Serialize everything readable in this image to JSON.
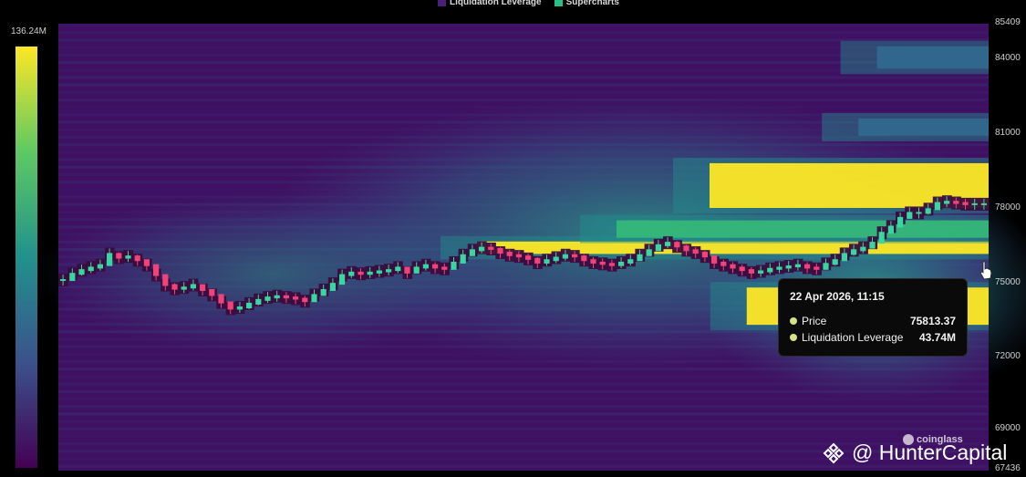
{
  "legend": {
    "items": [
      {
        "label": "Liquidation Leverage",
        "color": "#4a1f78"
      },
      {
        "label": "Supercharts",
        "color": "#26c08a"
      }
    ]
  },
  "color_scale": {
    "max_label": "136.24M",
    "colors": [
      "#440154",
      "#3b528b",
      "#21918c",
      "#5ec962",
      "#fde725"
    ]
  },
  "tooltip": {
    "date": "22 Apr 2026, 11:15",
    "rows": [
      {
        "label": "Price",
        "value": "75813.37"
      },
      {
        "label": "Liquidation Leverage",
        "value": "43.74M"
      }
    ]
  },
  "watermark": {
    "text": "coinglass",
    "icon": "coinglass-logo-icon"
  },
  "credit": {
    "text": "@ HunterCapital",
    "icon": "binance-logo-icon"
  },
  "chart_data": {
    "type": "heatmap",
    "title": "",
    "y_axis": {
      "ticks": [
        "85409",
        "84000",
        "81000",
        "78000",
        "75000",
        "72000",
        "69000",
        "67436"
      ],
      "range": [
        67436,
        85409
      ]
    },
    "price_series": {
      "name": "Price",
      "values": [
        75100,
        75350,
        75500,
        75600,
        75700,
        76150,
        76000,
        76050,
        75900,
        75700,
        75300,
        74900,
        74750,
        74800,
        74900,
        74700,
        74500,
        74200,
        73950,
        74000,
        74150,
        74300,
        74400,
        74450,
        74400,
        74350,
        74250,
        74500,
        74700,
        74950,
        75300,
        75400,
        75350,
        75400,
        75450,
        75500,
        75600,
        75400,
        75600,
        75700,
        75600,
        75550,
        75800,
        76100,
        76300,
        76400,
        76350,
        76200,
        76100,
        76050,
        75950,
        75800,
        75900,
        76000,
        76100,
        76050,
        75900,
        75800,
        75750,
        75700,
        75800,
        75900,
        76100,
        76300,
        76500,
        76600,
        76450,
        76300,
        76200,
        76050,
        75800,
        75700,
        75600,
        75500,
        75400,
        75450,
        75550,
        75600,
        75650,
        75700,
        75600,
        75550,
        75750,
        75900,
        76150,
        76300,
        76400,
        76600,
        77000,
        77250,
        77600,
        77800,
        77800,
        77950,
        78200,
        78250,
        78200,
        78150,
        78150,
        78150
      ]
    },
    "heat_bands": [
      {
        "price_range": [
          78000,
          79800
        ],
        "start_fraction": 0.7,
        "intensity": 1.0
      },
      {
        "price_range": [
          76150,
          76650
        ],
        "start_fraction": 0.45,
        "intensity": 1.0
      },
      {
        "price_range": [
          73300,
          74800
        ],
        "start_fraction": 0.74,
        "intensity": 0.95
      },
      {
        "price_range": [
          76800,
          77500
        ],
        "start_fraction": 0.6,
        "intensity": 0.55
      },
      {
        "price_range": [
          80900,
          81600
        ],
        "start_fraction": 0.86,
        "intensity": 0.45
      },
      {
        "price_range": [
          83600,
          84500
        ],
        "start_fraction": 0.88,
        "intensity": 0.35
      }
    ]
  }
}
